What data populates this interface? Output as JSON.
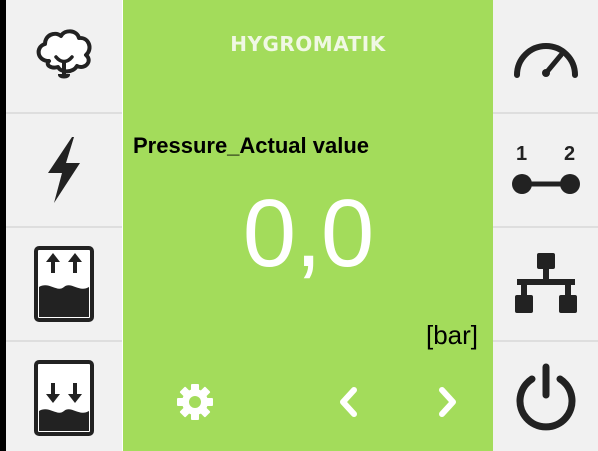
{
  "header": {
    "brand": "HYGROMATIK"
  },
  "display": {
    "parameter_label": "Pressure_Actual value",
    "value": "0,0",
    "unit": "[bar]"
  },
  "left_nav": [
    {
      "icon": "cloud-steam-icon"
    },
    {
      "icon": "lightning-bolt-icon"
    },
    {
      "icon": "tank-fill-up-icon"
    },
    {
      "icon": "tank-drain-down-icon"
    }
  ],
  "right_nav": [
    {
      "icon": "gauge-icon"
    },
    {
      "icon": "link-1-2-icon",
      "labels": [
        "1",
        "2"
      ]
    },
    {
      "icon": "network-icon"
    },
    {
      "icon": "power-icon"
    }
  ],
  "bottom_bar": [
    {
      "icon": "gear-icon"
    },
    {
      "icon": "chevron-left-icon"
    },
    {
      "icon": "chevron-right-icon"
    }
  ],
  "colors": {
    "accent_green": "#a3dc5b",
    "tile_bg": "#f1f1f1",
    "icon_dark": "#222222",
    "value_text": "#ffffff"
  }
}
